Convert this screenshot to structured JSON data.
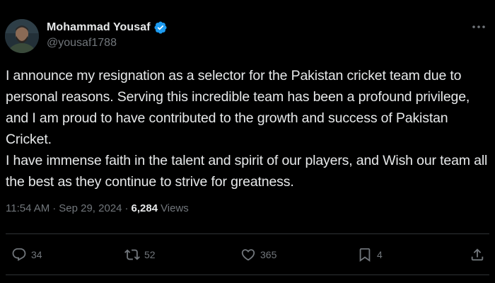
{
  "post": {
    "author": {
      "name": "Mohammad Yousaf",
      "handle": "@yousaf1788",
      "verified": true
    },
    "text": "I announce my resignation as a selector for the Pakistan cricket team due to personal reasons. Serving this incredible team has been a profound privilege, and I am proud to have contributed to the growth and success of Pakistan Cricket.\nI have immense faith in the talent and spirit of our players, and Wish our team all the best as they continue to strive for greatness.",
    "meta": {
      "time": "11:54 AM",
      "date": "Sep 29, 2024",
      "separator": "·",
      "views_count": "6,284",
      "views_label": "Views"
    },
    "actions": {
      "replies": "34",
      "reposts": "52",
      "likes": "365",
      "bookmarks": "4"
    }
  },
  "icons": {
    "verified": "verified-badge-icon",
    "more": "more-options-icon",
    "reply": "reply-icon",
    "repost": "repost-icon",
    "like": "heart-icon",
    "bookmark": "bookmark-icon",
    "share": "share-icon"
  },
  "colors": {
    "background": "#000000",
    "text_primary": "#e7e9ea",
    "text_secondary": "#71767b",
    "verified_blue": "#1d9bf0",
    "divider": "#2f3336"
  }
}
